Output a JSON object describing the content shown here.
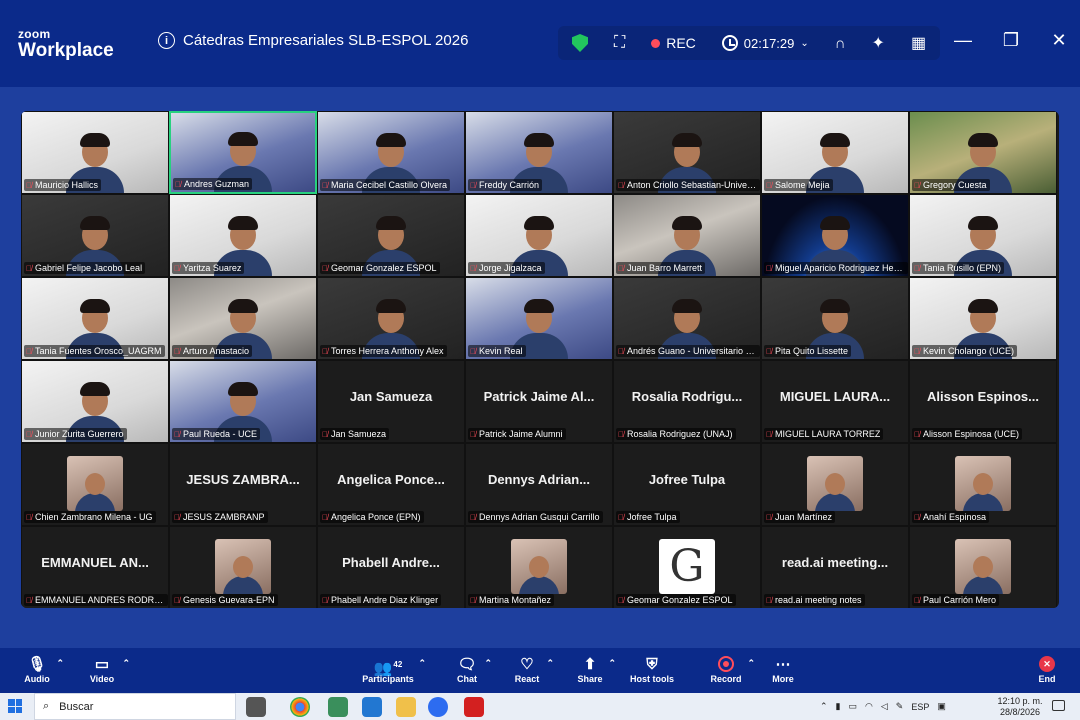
{
  "app": {
    "logo_top": "zoom",
    "logo_bottom": "Workplace",
    "meeting_title": "Cátedras Empresariales SLB-ESPOL 2026"
  },
  "titlebar": {
    "rec_label": "REC",
    "timer": "02:17:29"
  },
  "participants": [
    {
      "name": "Mauricio Hallics",
      "kind": "video",
      "style": "white"
    },
    {
      "name": "Andres Guzman",
      "kind": "video",
      "style": "blue",
      "active": true
    },
    {
      "name": "Maria Cecibel Castillo Olvera",
      "kind": "video",
      "style": "blue"
    },
    {
      "name": "Freddy Carrión",
      "kind": "video",
      "style": "blue"
    },
    {
      "name": "Anton Criollo Sebastian-Univer...",
      "kind": "video",
      "style": "dark"
    },
    {
      "name": "Salome Mejia",
      "kind": "video",
      "style": "white"
    },
    {
      "name": "Gregory Cuesta",
      "kind": "video",
      "style": "green"
    },
    {
      "name": "Gabriel Felipe Jacobo Leal",
      "kind": "video",
      "style": "dark"
    },
    {
      "name": "Yaritza Suarez",
      "kind": "video",
      "style": "white"
    },
    {
      "name": "Geomar Gonzalez ESPOL",
      "kind": "video",
      "style": "dark"
    },
    {
      "name": "Jorge Jigalzaca",
      "kind": "video",
      "style": "white"
    },
    {
      "name": "Juan Barro Marrett",
      "kind": "video",
      "style": "video"
    },
    {
      "name": "Miguel Aparicio Rodriguez Herr...",
      "kind": "video",
      "style": "space"
    },
    {
      "name": "Tania Rusillo (EPN)",
      "kind": "video",
      "style": "white"
    },
    {
      "name": "Tania Fuentes Orosco_UAGRM",
      "kind": "video",
      "style": "white"
    },
    {
      "name": "Arturo Anastacio",
      "kind": "video",
      "style": "video"
    },
    {
      "name": "Torres Herrera Anthony Alex",
      "kind": "video",
      "style": "dark"
    },
    {
      "name": "Kevin Real",
      "kind": "video",
      "style": "blue"
    },
    {
      "name": "Andrés Guano - Universitario R...",
      "kind": "video",
      "style": "dark"
    },
    {
      "name": "Pita Quito Lissette",
      "kind": "video",
      "style": "dark"
    },
    {
      "name": "Kevin Cholango (UCE)",
      "kind": "video",
      "style": "white"
    },
    {
      "name": "Junior Zurita Guerrero",
      "kind": "video",
      "style": "white"
    },
    {
      "name": "Paul Rueda - UCE",
      "kind": "video",
      "style": "blue"
    },
    {
      "name": "Jan Samueza",
      "kind": "name",
      "display": "Jan Samueza"
    },
    {
      "name": "Patrick Jaime Alumni",
      "kind": "name",
      "display": "Patrick  Jaime  Al..."
    },
    {
      "name": "Rosalia Rodriguez (UNAJ)",
      "kind": "name",
      "display": "Rosalia  Rodrigu..."
    },
    {
      "name": "MIGUEL LAURA TORREZ",
      "kind": "name",
      "display": "MIGUEL  LAURA..."
    },
    {
      "name": "Alisson Espinosa (UCE)",
      "kind": "name",
      "display": "Alisson  Espinos..."
    },
    {
      "name": "Chien Zambrano Milena - UG",
      "kind": "avatar"
    },
    {
      "name": "JESUS ZAMBRANP",
      "kind": "name",
      "display": "JESUS  ZAMBRA..."
    },
    {
      "name": "Angelica Ponce (EPN)",
      "kind": "name",
      "display": "Angelica  Ponce..."
    },
    {
      "name": "Dennys Adrian Gusqui Carrillo",
      "kind": "name",
      "display": "Dennys  Adrian..."
    },
    {
      "name": "Jofree Tulpa",
      "kind": "name",
      "display": "Jofree  Tulpa"
    },
    {
      "name": "Juan Martínez",
      "kind": "avatar"
    },
    {
      "name": "Anahí Espinosa",
      "kind": "avatar"
    },
    {
      "name": "EMMANUEL ANDRES RODRIG...",
      "kind": "name",
      "display": "EMMANUEL  AN..."
    },
    {
      "name": "Genesis Guevara-EPN",
      "kind": "avatar"
    },
    {
      "name": "Phabell Andre Diaz Klinger",
      "kind": "name",
      "display": "Phabell  Andre..."
    },
    {
      "name": "Martina Montañez",
      "kind": "avatar"
    },
    {
      "name": "Geomar Gonzalez ESPOL",
      "kind": "avatar-g",
      "letter": "G"
    },
    {
      "name": "read.ai meeting notes",
      "kind": "name",
      "display": "read.ai  meeting..."
    },
    {
      "name": "Paul Carrión Mero",
      "kind": "avatar"
    }
  ],
  "toolbar": {
    "audio": "Audio",
    "video": "Video",
    "participants": "Participants",
    "participants_count": "42",
    "chat": "Chat",
    "react": "React",
    "share": "Share",
    "host_tools": "Host tools",
    "record": "Record",
    "more": "More",
    "end": "End"
  },
  "taskbar": {
    "search_placeholder": "Buscar",
    "lang": "ESP",
    "time": "12:10 p. m.",
    "date": "28/8/2026"
  }
}
